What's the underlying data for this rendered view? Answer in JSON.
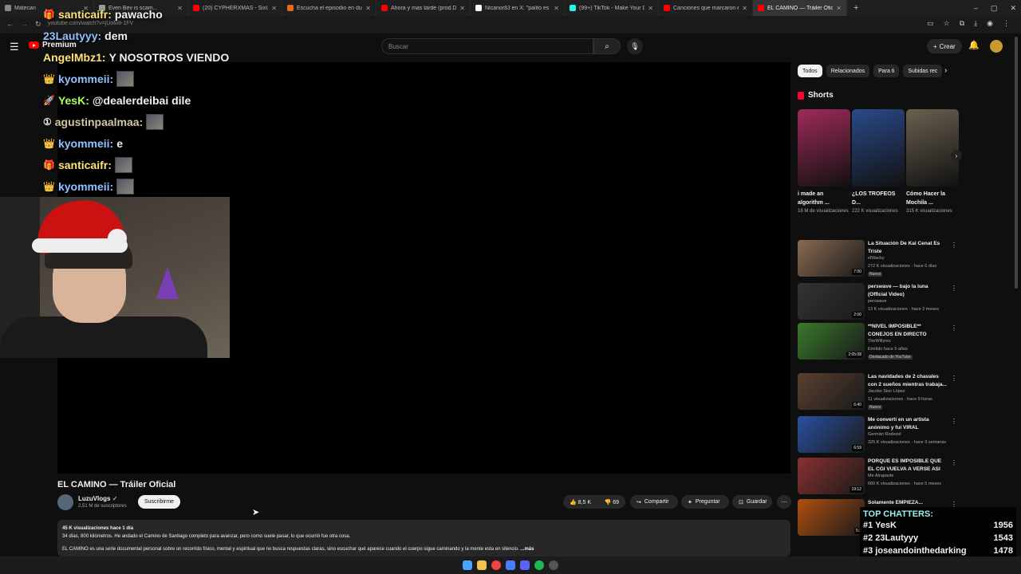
{
  "browser": {
    "tabs": [
      {
        "title": "Matecan",
        "color": "#888888"
      },
      {
        "title": "Even Bev is scam...",
        "color": "#999999"
      },
      {
        "title": "(20) CYPHERXMAS - SixUp, Jos...",
        "color": "#ff0000"
      },
      {
        "title": "Escucha el episodio en du fl...",
        "color": "#e96a1f"
      },
      {
        "title": "Ahora y mas tarde (prod.Darde...",
        "color": "#ff0000"
      },
      {
        "title": "Nicanor8J en X: \"palito es autis\"",
        "color": "#ffffff"
      },
      {
        "title": "(99+) TikTok - Make Your Day",
        "color": "#25f4ee"
      },
      {
        "title": "Canciones que marcaron el 20...",
        "color": "#ff0000"
      },
      {
        "title": "EL CAMINO — Tráiler Oficial",
        "color": "#ff0000"
      }
    ],
    "url": "youtube.com/watch?v=jUoM8-1FV"
  },
  "header": {
    "brand": "Premium",
    "search_placeholder": "Buscar",
    "create_label": "Crear"
  },
  "chat": [
    {
      "user": "santicaifr",
      "text": "pawacho",
      "color": "#ffe37a",
      "badge": "🎁"
    },
    {
      "user": "23Lautyyy",
      "text": "dem",
      "color": "#8fc3ff",
      "badge": ""
    },
    {
      "user": "AngelMbz1",
      "text": "Y NOSOTROS VIENDO",
      "color": "#ffe37a",
      "badge": ""
    },
    {
      "user": "kyommeii",
      "text": "",
      "color": "#8fc3ff",
      "badge": "👑"
    },
    {
      "user": "YesK",
      "text": "@dealerdeibai dile",
      "color": "#a7ff5c",
      "badge": "🚀"
    },
    {
      "user": "agustinpaalmaa",
      "text": "",
      "color": "#d3c6a0",
      "badge": "①"
    },
    {
      "user": "kyommeii",
      "text": "e",
      "color": "#8fc3ff",
      "badge": "👑"
    },
    {
      "user": "santicaifr",
      "text": "",
      "color": "#ffe37a",
      "badge": "🎁"
    },
    {
      "user": "kyommeii",
      "text": "",
      "color": "#8fc3ff",
      "badge": "👑"
    }
  ],
  "video": {
    "title": "EL CAMINO — Tráiler Oficial",
    "channel": "LuzuVlogs",
    "subscribers": "2,51 M de suscriptores",
    "subscribe_label": "Suscribirme",
    "likes": "8,5 K",
    "dislikes": "69",
    "share_label": "Compartir",
    "ask_label": "Preguntar",
    "save_label": "Guardar",
    "desc_stats": "45 K visualizaciones  hace 1 día",
    "desc_line1": "34 días, 800 kilómetros. He andado el Camino de Santiago completo para avanzar, pero como suele pasar, lo que ocurrió fue otra cosa.",
    "desc_line2": "EL CAMINO es una serie documental personal sobre un recorrido físico, mental y espiritual que no busca respuestas claras, sino escuchar qué aparece cuando el cuerpo sigue caminando y la mente esta en silencio.",
    "desc_more": "...más"
  },
  "chips": [
    "Todos",
    "Relacionados",
    "Para ti",
    "Subidas rec"
  ],
  "shorts": {
    "heading": "Shorts",
    "items": [
      {
        "title": "i made an algorithm ...",
        "views": "18 M de visualizaciones",
        "color": "#a02a5a"
      },
      {
        "title": "¿LOS TROFEOS D...",
        "views": "222 K visualizaciones",
        "color": "#2a4a8a"
      },
      {
        "title": "Cómo Hacer la Mochila ...",
        "views": "315 K visualizaciones",
        "color": "#6a6050"
      }
    ]
  },
  "recommendations": [
    {
      "title": "La Situación De Kai Cenat Es Triste",
      "channel": "elWacky",
      "meta": "272 K visualizaciones · hace 6 días",
      "tag": "Nuevo",
      "duration": "7:00",
      "color": "#8a6a50"
    },
    {
      "title": "perswave — bajo la luna (Official Video)",
      "channel": "perswave",
      "meta": "13 K visualizaciones · hace 3 meses",
      "tag": "",
      "duration": "2:00",
      "color": "#333333"
    },
    {
      "title": "**NIVEL IMPOSIBLE** CONEJOS EN DIRECTO",
      "channel": "TheWillyrex",
      "meta": "Emitido hace 5 años",
      "tag": "Destacado de YouTube",
      "duration": "2:05:08",
      "color": "#3a7a2a"
    },
    {
      "title": "Las navidades de 2 chavales con 2 sueños mientras trabaja...",
      "channel": "Jacobo Siso López",
      "meta": "11 visualizaciones · hace 9 horas",
      "tag": "Nuevo",
      "duration": "6:40",
      "color": "#5a4030"
    },
    {
      "title": "Me convertí en un artista anónimo y fui VIRAL",
      "channel": "Germán Rodezel",
      "meta": "325 K visualizaciones · hace 3 semanas",
      "tag": "",
      "duration": "6:59",
      "color": "#2a50a0"
    },
    {
      "title": "PORQUE ES IMPOSIBLE QUE EL CGI VUELVA A VERSE ASI",
      "channel": "Me Atrapaste",
      "meta": "660 K visualizaciones · hace 5 meses",
      "tag": "",
      "duration": "19:12",
      "color": "#8a3030"
    },
    {
      "title": "Solamente EMPIEZA...",
      "channel": "",
      "meta": "",
      "tag": "",
      "duration": "5:2",
      "color": "#b05010"
    }
  ],
  "top_chatters": {
    "title": "TOP CHATTERS:",
    "rows": [
      {
        "rank": "#1",
        "name": "YesK",
        "count": "1956"
      },
      {
        "rank": "#2",
        "name": "23Lautyyy",
        "count": "1543"
      },
      {
        "rank": "#3",
        "name": "joseandointhedarking",
        "count": "1478"
      }
    ]
  }
}
